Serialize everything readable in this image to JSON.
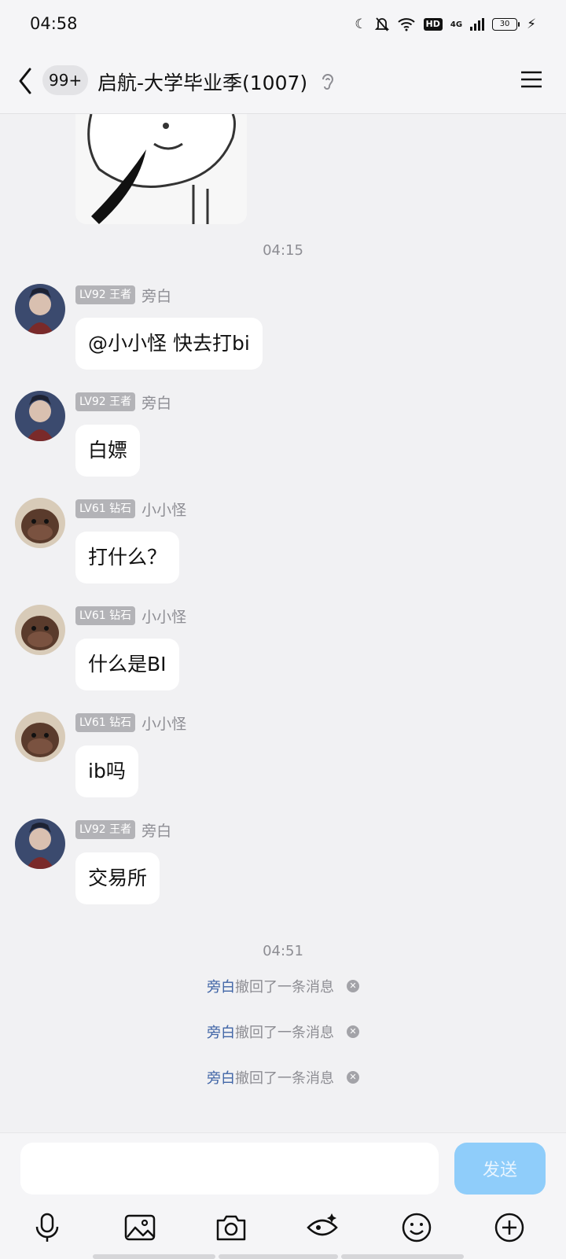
{
  "status_bar": {
    "time": "04:58",
    "battery": "30",
    "hd": "HD",
    "network": "4G"
  },
  "header": {
    "unread_count": "99+",
    "title": "启航-大学毕业季(1007)"
  },
  "chat": {
    "timestamps": [
      "04:15",
      "04:51"
    ],
    "messages": [
      {
        "level": "LV92 王者",
        "sender": "旁白",
        "text": "@小小怪 快去打bi",
        "avatar": "avatar-pangbai"
      },
      {
        "level": "LV92 王者",
        "sender": "旁白",
        "text": "白嫖",
        "avatar": "avatar-pangbai"
      },
      {
        "level": "LV61 钻石",
        "sender": "小小怪",
        "text": "打什么？",
        "avatar": "avatar-xiaoxiaoguai"
      },
      {
        "level": "LV61 钻石",
        "sender": "小小怪",
        "text": "什么是BI",
        "avatar": "avatar-xiaoxiaoguai"
      },
      {
        "level": "LV61 钻石",
        "sender": "小小怪",
        "text": "ib吗",
        "avatar": "avatar-xiaoxiaoguai"
      },
      {
        "level": "LV92 王者",
        "sender": "旁白",
        "text": "交易所",
        "avatar": "avatar-pangbai"
      }
    ],
    "recalls": [
      {
        "who": "旁白",
        "text": "撤回了一条消息"
      },
      {
        "who": "旁白",
        "text": "撤回了一条消息"
      },
      {
        "who": "旁白",
        "text": "撤回了一条消息"
      }
    ]
  },
  "input": {
    "placeholder": "",
    "send_label": "发送"
  },
  "toolbar": [
    "microphone-icon",
    "image-icon",
    "camera-icon",
    "red-packet-icon",
    "emoji-icon",
    "plus-icon"
  ],
  "colors": {
    "send_button": "#8fcdfa",
    "recall_name": "#3f64a6",
    "background": "#f1f1f3"
  }
}
